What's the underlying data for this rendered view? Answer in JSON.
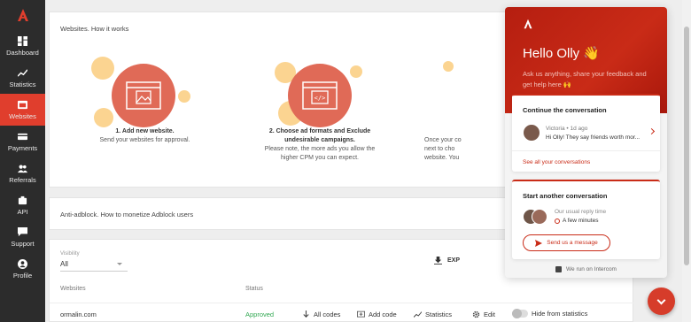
{
  "sidebar": {
    "logo_icon": "agency-logo-icon",
    "items": [
      {
        "label": "Dashboard",
        "icon": "dashboard-icon",
        "active": false
      },
      {
        "label": "Statistics",
        "icon": "statistics-icon",
        "active": false
      },
      {
        "label": "Websites",
        "icon": "websites-icon",
        "active": true
      },
      {
        "label": "Payments",
        "icon": "payments-icon",
        "active": false
      },
      {
        "label": "Referrals",
        "icon": "referrals-icon",
        "active": false
      },
      {
        "label": "API",
        "icon": "api-icon",
        "active": false
      },
      {
        "label": "Support",
        "icon": "support-icon",
        "active": false
      },
      {
        "label": "Profile",
        "icon": "profile-icon",
        "active": false
      }
    ]
  },
  "how_it_works": {
    "title": "Websites. How it works",
    "steps": [
      {
        "title": "1. Add new website.",
        "text": "Send your websites for approval."
      },
      {
        "title": "2. Choose ad formats and Exclude undesirable campaigns.",
        "text": "Please note, the more ads you allow the higher CPM you can expect."
      },
      {
        "title": "",
        "text": "Once your co next to cho website. You"
      }
    ]
  },
  "adblock": {
    "title": "Anti-adblock. How to monetize Adblock users"
  },
  "websites_table": {
    "visibility_label": "Visibility",
    "visibility_value": "All",
    "export_label": "EXP",
    "columns": [
      "Websites",
      "Status"
    ],
    "rows": [
      {
        "website": "ormalin.com",
        "status": "Approved",
        "all_codes": "All codes",
        "add_code": "Add code",
        "statistics": "Statistics",
        "edit": "Edit",
        "hide": "Hide from statistics"
      }
    ]
  },
  "messenger": {
    "greeting": "Hello Olly 👋",
    "subtitle": "Ask us anything, share your feedback and get help here 🙌",
    "continue_title": "Continue the conversation",
    "conversation": {
      "name": "Victoria",
      "time": "• 1d ago",
      "message": "Hi Olly! They say friends worth mor..."
    },
    "see_all": "See all your conversations",
    "start_title": "Start another conversation",
    "reply_label": "Our usual reply time",
    "reply_value": "A few minutes",
    "send_button": "Send us a message",
    "footer": "We run on Intercom"
  },
  "colors": {
    "accent": "#e03e2d",
    "sidebar_bg": "#2c2c2c",
    "approved": "#32a852"
  }
}
